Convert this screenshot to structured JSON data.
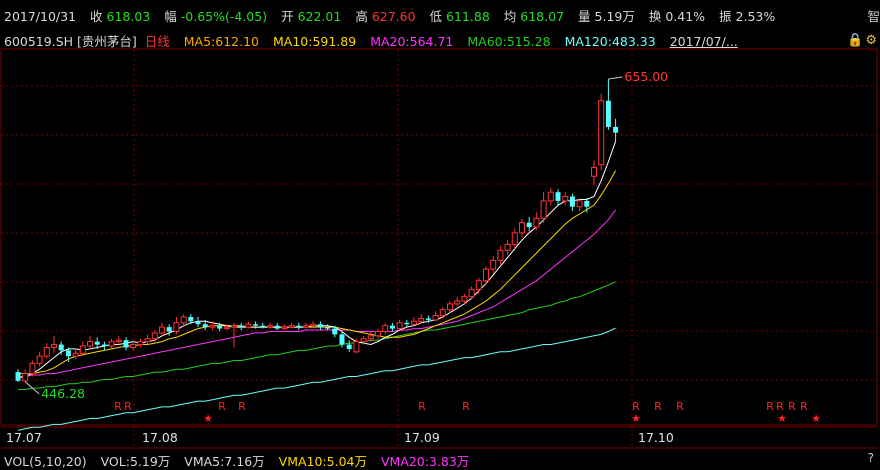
{
  "quote": {
    "date": "2017/10/31",
    "close_label": "收",
    "close": "618.03",
    "change_label": "幅",
    "change": "-0.65%(-4.05)",
    "open_label": "开",
    "open": "622.01",
    "high_label": "高",
    "high": "627.60",
    "low_label": "低",
    "low": "611.88",
    "avg_label": "均",
    "avg": "618.07",
    "vol_label": "量",
    "vol": "5.19万",
    "turnover_label": "换",
    "turnover": "0.41%",
    "amp_label": "振",
    "amp": "2.53%",
    "cut": "智"
  },
  "ma": {
    "code": "600519.SH",
    "name": "[贵州茅台]",
    "period": "日线",
    "ma5": "MA5:612.10",
    "ma10": "MA10:591.89",
    "ma20": "MA20:564.71",
    "ma60": "MA60:515.28",
    "ma120": "MA120:483.33",
    "date_btn": "2017/07/...",
    "icons": [
      "lock-icon",
      "gear-icon"
    ]
  },
  "volume": {
    "title": "VOL(5,10,20)",
    "vol": "VOL:5.19万",
    "vma5": "VMA5:7.16万",
    "vma10": "VMA10:5.04万",
    "vma20": "VMA20:3.83万",
    "help": "?"
  },
  "colors": {
    "up": "#ff3232",
    "down": "#54ffff",
    "ma5": "#ffffff",
    "ma10": "#ffd700",
    "ma20": "#ff33ff",
    "ma60": "#22cc22",
    "ma120": "#66ffff",
    "grid": "#7a0000"
  },
  "chart_data": {
    "type": "candlestick",
    "x_labels": [
      "17.07",
      "17.08",
      "17.09",
      "17.10"
    ],
    "ylim": [
      420,
      675
    ],
    "annotations": [
      {
        "text": "446.28",
        "value": 446.28,
        "index": 1
      },
      {
        "text": "655.00",
        "value": 655.0,
        "index": 82
      }
    ],
    "candles": [
      {
        "o": 453,
        "c": 447,
        "h": 455,
        "l": 446.28
      },
      {
        "o": 447,
        "c": 452,
        "h": 455,
        "l": 446
      },
      {
        "o": 452,
        "c": 459,
        "h": 461,
        "l": 450
      },
      {
        "o": 459,
        "c": 464,
        "h": 467,
        "l": 457
      },
      {
        "o": 464,
        "c": 470,
        "h": 473,
        "l": 462
      },
      {
        "o": 470,
        "c": 472,
        "h": 478,
        "l": 466
      },
      {
        "o": 472,
        "c": 468,
        "h": 474,
        "l": 465
      },
      {
        "o": 468,
        "c": 464,
        "h": 470,
        "l": 460
      },
      {
        "o": 464,
        "c": 466,
        "h": 469,
        "l": 462
      },
      {
        "o": 466,
        "c": 471,
        "h": 474,
        "l": 464
      },
      {
        "o": 471,
        "c": 474,
        "h": 478,
        "l": 469
      },
      {
        "o": 474,
        "c": 472,
        "h": 477,
        "l": 469
      },
      {
        "o": 472,
        "c": 471,
        "h": 474,
        "l": 468
      },
      {
        "o": 471,
        "c": 474,
        "h": 476,
        "l": 469
      },
      {
        "o": 474,
        "c": 475,
        "h": 478,
        "l": 472
      },
      {
        "o": 475,
        "c": 470,
        "h": 477,
        "l": 468
      },
      {
        "o": 470,
        "c": 472,
        "h": 474,
        "l": 468
      },
      {
        "o": 472,
        "c": 474,
        "h": 476,
        "l": 470
      },
      {
        "o": 474,
        "c": 476,
        "h": 479,
        "l": 472
      },
      {
        "o": 476,
        "c": 480,
        "h": 482,
        "l": 474
      },
      {
        "o": 480,
        "c": 484,
        "h": 487,
        "l": 478
      },
      {
        "o": 484,
        "c": 481,
        "h": 486,
        "l": 478
      },
      {
        "o": 481,
        "c": 487,
        "h": 491,
        "l": 479
      },
      {
        "o": 487,
        "c": 491,
        "h": 493,
        "l": 484
      },
      {
        "o": 491,
        "c": 488,
        "h": 493,
        "l": 486
      },
      {
        "o": 488,
        "c": 486,
        "h": 491,
        "l": 484
      },
      {
        "o": 486,
        "c": 484,
        "h": 489,
        "l": 482
      },
      {
        "o": 484,
        "c": 485,
        "h": 488,
        "l": 482
      },
      {
        "o": 485,
        "c": 483,
        "h": 487,
        "l": 481
      },
      {
        "o": 483,
        "c": 484,
        "h": 486,
        "l": 482
      },
      {
        "o": 484,
        "c": 485,
        "h": 487,
        "l": 470
      },
      {
        "o": 485,
        "c": 484,
        "h": 487,
        "l": 482
      },
      {
        "o": 484,
        "c": 486,
        "h": 488,
        "l": 483
      },
      {
        "o": 486,
        "c": 485,
        "h": 488,
        "l": 483
      },
      {
        "o": 485,
        "c": 484,
        "h": 487,
        "l": 483
      },
      {
        "o": 484,
        "c": 485,
        "h": 487,
        "l": 483
      },
      {
        "o": 485,
        "c": 483,
        "h": 487,
        "l": 482
      },
      {
        "o": 483,
        "c": 484,
        "h": 486,
        "l": 482
      },
      {
        "o": 484,
        "c": 485,
        "h": 487,
        "l": 483
      },
      {
        "o": 485,
        "c": 484,
        "h": 487,
        "l": 482
      },
      {
        "o": 484,
        "c": 485,
        "h": 487,
        "l": 483
      },
      {
        "o": 485,
        "c": 486,
        "h": 488,
        "l": 484
      },
      {
        "o": 486,
        "c": 484,
        "h": 488,
        "l": 482
      },
      {
        "o": 484,
        "c": 483,
        "h": 486,
        "l": 482
      },
      {
        "o": 483,
        "c": 479,
        "h": 485,
        "l": 477
      },
      {
        "o": 479,
        "c": 472,
        "h": 481,
        "l": 470
      },
      {
        "o": 472,
        "c": 469,
        "h": 475,
        "l": 467
      },
      {
        "o": 467,
        "c": 474,
        "h": 476,
        "l": 466
      },
      {
        "o": 474,
        "c": 476,
        "h": 478,
        "l": 472
      },
      {
        "o": 476,
        "c": 478,
        "h": 481,
        "l": 474
      },
      {
        "o": 478,
        "c": 481,
        "h": 483,
        "l": 476
      },
      {
        "o": 481,
        "c": 485,
        "h": 487,
        "l": 479
      },
      {
        "o": 485,
        "c": 483,
        "h": 487,
        "l": 481
      },
      {
        "o": 483,
        "c": 487,
        "h": 489,
        "l": 482
      },
      {
        "o": 487,
        "c": 486,
        "h": 489,
        "l": 484
      },
      {
        "o": 486,
        "c": 488,
        "h": 491,
        "l": 485
      },
      {
        "o": 488,
        "c": 490,
        "h": 493,
        "l": 487
      },
      {
        "o": 490,
        "c": 489,
        "h": 492,
        "l": 487
      },
      {
        "o": 489,
        "c": 492,
        "h": 495,
        "l": 488
      },
      {
        "o": 492,
        "c": 496,
        "h": 498,
        "l": 490
      },
      {
        "o": 496,
        "c": 500,
        "h": 502,
        "l": 494
      },
      {
        "o": 500,
        "c": 502,
        "h": 505,
        "l": 498
      },
      {
        "o": 502,
        "c": 505,
        "h": 507,
        "l": 500
      },
      {
        "o": 505,
        "c": 510,
        "h": 512,
        "l": 503
      },
      {
        "o": 510,
        "c": 516,
        "h": 518,
        "l": 507
      },
      {
        "o": 516,
        "c": 524,
        "h": 526,
        "l": 513
      },
      {
        "o": 524,
        "c": 530,
        "h": 533,
        "l": 521
      },
      {
        "o": 530,
        "c": 537,
        "h": 540,
        "l": 527
      },
      {
        "o": 537,
        "c": 541,
        "h": 544,
        "l": 534
      },
      {
        "o": 541,
        "c": 549,
        "h": 552,
        "l": 538
      },
      {
        "o": 549,
        "c": 556,
        "h": 559,
        "l": 546
      },
      {
        "o": 556,
        "c": 553,
        "h": 560,
        "l": 550
      },
      {
        "o": 553,
        "c": 559,
        "h": 563,
        "l": 551
      },
      {
        "o": 559,
        "c": 571,
        "h": 577,
        "l": 556
      },
      {
        "o": 571,
        "c": 577,
        "h": 580,
        "l": 568
      },
      {
        "o": 577,
        "c": 571,
        "h": 579,
        "l": 568
      },
      {
        "o": 571,
        "c": 574,
        "h": 577,
        "l": 568
      },
      {
        "o": 574,
        "c": 567,
        "h": 576,
        "l": 564
      },
      {
        "o": 567,
        "c": 571,
        "h": 573,
        "l": 564
      },
      {
        "o": 571,
        "c": 567,
        "h": 573,
        "l": 563
      },
      {
        "o": 588,
        "c": 594,
        "h": 599,
        "l": 582
      },
      {
        "o": 596,
        "c": 640,
        "h": 645,
        "l": 592
      },
      {
        "o": 640,
        "c": 622,
        "h": 655.0,
        "l": 620
      },
      {
        "o": 622,
        "c": 618.03,
        "h": 627.6,
        "l": 611.88
      }
    ],
    "ma": {
      "ma5": [
        449,
        450,
        452,
        455,
        459,
        463,
        467,
        469,
        469,
        468,
        469,
        470,
        471,
        472,
        472,
        473,
        474,
        473,
        474,
        475,
        478,
        480,
        482,
        485,
        487,
        488,
        488,
        487,
        486,
        485,
        484,
        484,
        484,
        484,
        484,
        484,
        484,
        484,
        484,
        484,
        484,
        485,
        485,
        485,
        484,
        481,
        477,
        474,
        473,
        472,
        474,
        477,
        479,
        482,
        484,
        485,
        487,
        488,
        489,
        491,
        494,
        497,
        500,
        504,
        509,
        514,
        520,
        526,
        532,
        538,
        544,
        549,
        553,
        558,
        563,
        568,
        571,
        571,
        572,
        572,
        574,
        585,
        598,
        612.1
      ],
      "ma10": [
        452,
        452,
        452,
        453,
        454,
        456,
        459,
        462,
        464,
        465,
        466,
        467,
        468,
        469,
        470,
        471,
        471,
        472,
        472,
        473,
        474,
        476,
        477,
        479,
        481,
        483,
        484,
        485,
        485,
        485,
        485,
        485,
        484,
        484,
        484,
        484,
        484,
        484,
        484,
        484,
        484,
        484,
        484,
        484,
        484,
        483,
        482,
        481,
        480,
        479,
        478,
        477,
        477,
        477,
        478,
        479,
        481,
        483,
        485,
        487,
        489,
        491,
        493,
        496,
        499,
        502,
        506,
        510,
        515,
        520,
        525,
        530,
        535,
        540,
        545,
        550,
        555,
        559,
        562,
        565,
        568,
        575,
        583,
        591.89
      ],
      "ma20": [
        450,
        450,
        451,
        451,
        452,
        452,
        453,
        454,
        455,
        456,
        457,
        458,
        459,
        460,
        461,
        462,
        463,
        464,
        465,
        466,
        467,
        468,
        469,
        470,
        471,
        472,
        473,
        474,
        475,
        476,
        477,
        478,
        479,
        480,
        480,
        481,
        481,
        481,
        481,
        481,
        482,
        482,
        482,
        482,
        482,
        482,
        482,
        481,
        481,
        481,
        481,
        481,
        481,
        482,
        482,
        483,
        483,
        484,
        485,
        486,
        487,
        488,
        490,
        492,
        494,
        496,
        498,
        501,
        504,
        507,
        510,
        513,
        516,
        520,
        524,
        528,
        532,
        536,
        540,
        544,
        548,
        553,
        558,
        564.71
      ],
      "ma60": [
        441,
        441,
        442,
        442,
        443,
        443,
        444,
        445,
        445,
        446,
        446,
        447,
        448,
        448,
        449,
        450,
        450,
        451,
        452,
        453,
        453,
        454,
        455,
        455,
        456,
        457,
        458,
        459,
        459,
        460,
        461,
        461,
        462,
        463,
        464,
        465,
        465,
        466,
        467,
        468,
        468,
        469,
        470,
        471,
        471,
        472,
        473,
        473,
        474,
        475,
        475,
        476,
        477,
        478,
        479,
        480,
        481,
        482,
        482,
        483,
        484,
        485,
        486,
        487,
        488,
        489,
        490,
        491,
        492,
        493,
        494,
        496,
        497,
        498,
        499,
        501,
        502,
        504,
        505,
        507,
        509,
        511,
        513,
        515.28
      ],
      "ma120": [
        413,
        414,
        415,
        415,
        416,
        417,
        417,
        418,
        419,
        420,
        421,
        421,
        422,
        423,
        424,
        425,
        425,
        426,
        427,
        428,
        429,
        429,
        430,
        431,
        432,
        433,
        433,
        434,
        435,
        436,
        437,
        437,
        438,
        439,
        440,
        441,
        442,
        442,
        443,
        444,
        445,
        446,
        446,
        447,
        448,
        449,
        450,
        450,
        451,
        452,
        453,
        454,
        454,
        455,
        456,
        457,
        458,
        458,
        459,
        460,
        461,
        462,
        463,
        463,
        464,
        465,
        466,
        467,
        467,
        468,
        469,
        470,
        471,
        472,
        472,
        473,
        474,
        475,
        476,
        477,
        478,
        479,
        481,
        483.33
      ]
    },
    "signals": [
      {
        "index": 13,
        "text": "R"
      },
      {
        "index": 14,
        "text": "R"
      },
      {
        "index": 23,
        "text": "★"
      },
      {
        "index": 25,
        "text": "R"
      },
      {
        "index": 28,
        "text": "R"
      },
      {
        "index": 50,
        "text": "R"
      },
      {
        "index": 56,
        "text": "R"
      },
      {
        "index": 76,
        "text": "R"
      },
      {
        "index": 76,
        "text": "★"
      },
      {
        "index": 79,
        "text": "R"
      },
      {
        "index": 82,
        "text": "R"
      },
      {
        "index": 94,
        "text": "R"
      },
      {
        "index": 95,
        "text": "R"
      },
      {
        "index": 96,
        "text": "R"
      },
      {
        "index": 97,
        "text": "R"
      },
      {
        "index": 95,
        "text": "★"
      },
      {
        "index": 99,
        "text": "★"
      }
    ]
  }
}
